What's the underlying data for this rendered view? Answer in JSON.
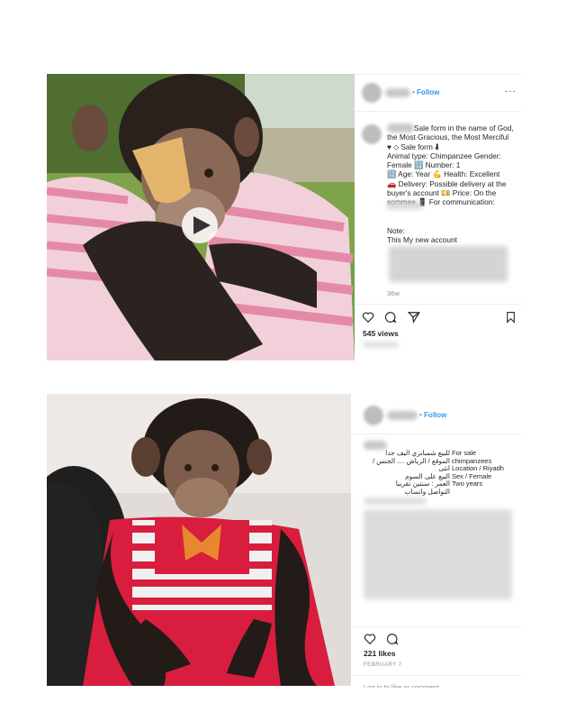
{
  "post1": {
    "follow_label": "Follow",
    "separator": "•",
    "more_label": "···",
    "caption": "Sale form in the name of God, the Most Gracious, the Most Merciful ♥ ⬦ Sale form ⬇\nAnimal type: Chimpanzee Gender: Female 🔢 Number: 1\n🔢 Age: Year 💪 Health: Excellent\n🚗 Delivery: Possible delivery at the buyer's account 💴 Price: On the sommee 📱 For communication:",
    "note_label": "Note:",
    "note_text": "This My new account",
    "timestamp": "36w",
    "views": "545 views"
  },
  "post2": {
    "follow_label": "Follow",
    "separator": "•",
    "arabic_lines": [
      "للبيع شمبانزي اليف جدا",
      "الموقع / الرياض .... الجنس / انثى",
      "البيع على السوم",
      "العمر : سنتين تقريبا",
      "التواصل واتساب"
    ],
    "english_lines": [
      "For sale",
      "chimpanzees",
      "Location / Riyadh",
      "Sex / Female",
      "Two years"
    ],
    "likes": "221 likes",
    "date": "FEBRUARY 7",
    "login_prompt": "Log in to like or comment."
  },
  "colors": {
    "accent": "#3897f0",
    "text": "#262626",
    "muted": "#8e8e8e"
  }
}
